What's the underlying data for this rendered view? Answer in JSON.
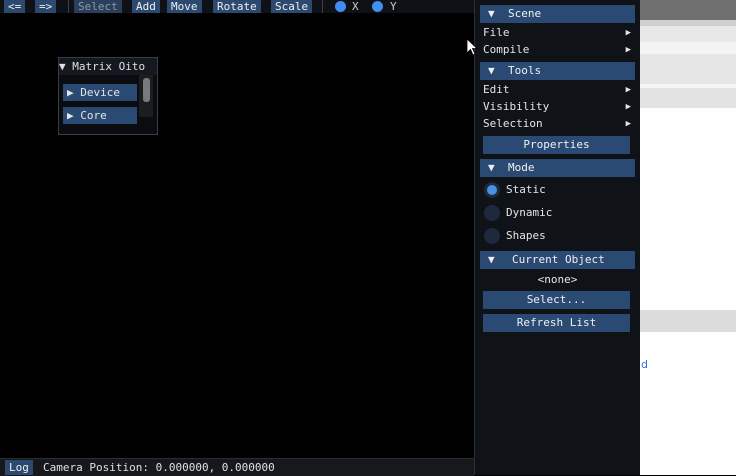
{
  "toolbar": {
    "back": "<=",
    "forward": "=>",
    "select": "Select",
    "add": "Add",
    "move": "Move",
    "rotate": "Rotate",
    "scale": "Scale",
    "axis_x": "X",
    "axis_y": "Y",
    "accent_color": "#3f8ef0"
  },
  "mini_window": {
    "title": "▼ Matrix Oito",
    "items": [
      "▶  Device",
      "▶  Core"
    ]
  },
  "status": {
    "log": "Log",
    "camera": "Camera Position: 0.000000, 0.000000"
  },
  "panel": {
    "scene": {
      "arrow": "▼",
      "title": "Scene",
      "items": [
        {
          "label": "File",
          "sub": "▶"
        },
        {
          "label": "Compile",
          "sub": "▶"
        }
      ]
    },
    "tools": {
      "arrow": "▼",
      "title": "Tools",
      "items": [
        {
          "label": "Edit",
          "sub": "▶"
        },
        {
          "label": "Visibility",
          "sub": "▶"
        },
        {
          "label": "Selection",
          "sub": "▶"
        }
      ],
      "properties_button": "Properties"
    },
    "mode": {
      "arrow": "▼",
      "title": "Mode",
      "options": [
        "Static",
        "Dynamic",
        "Shapes"
      ],
      "selected": "Static"
    },
    "current_object": {
      "arrow": "▼",
      "title": "Current Object",
      "value": "<none>",
      "select_button": "Select...",
      "refresh_button": "Refresh List"
    }
  },
  "background_app": {
    "link_fragment": "d"
  }
}
